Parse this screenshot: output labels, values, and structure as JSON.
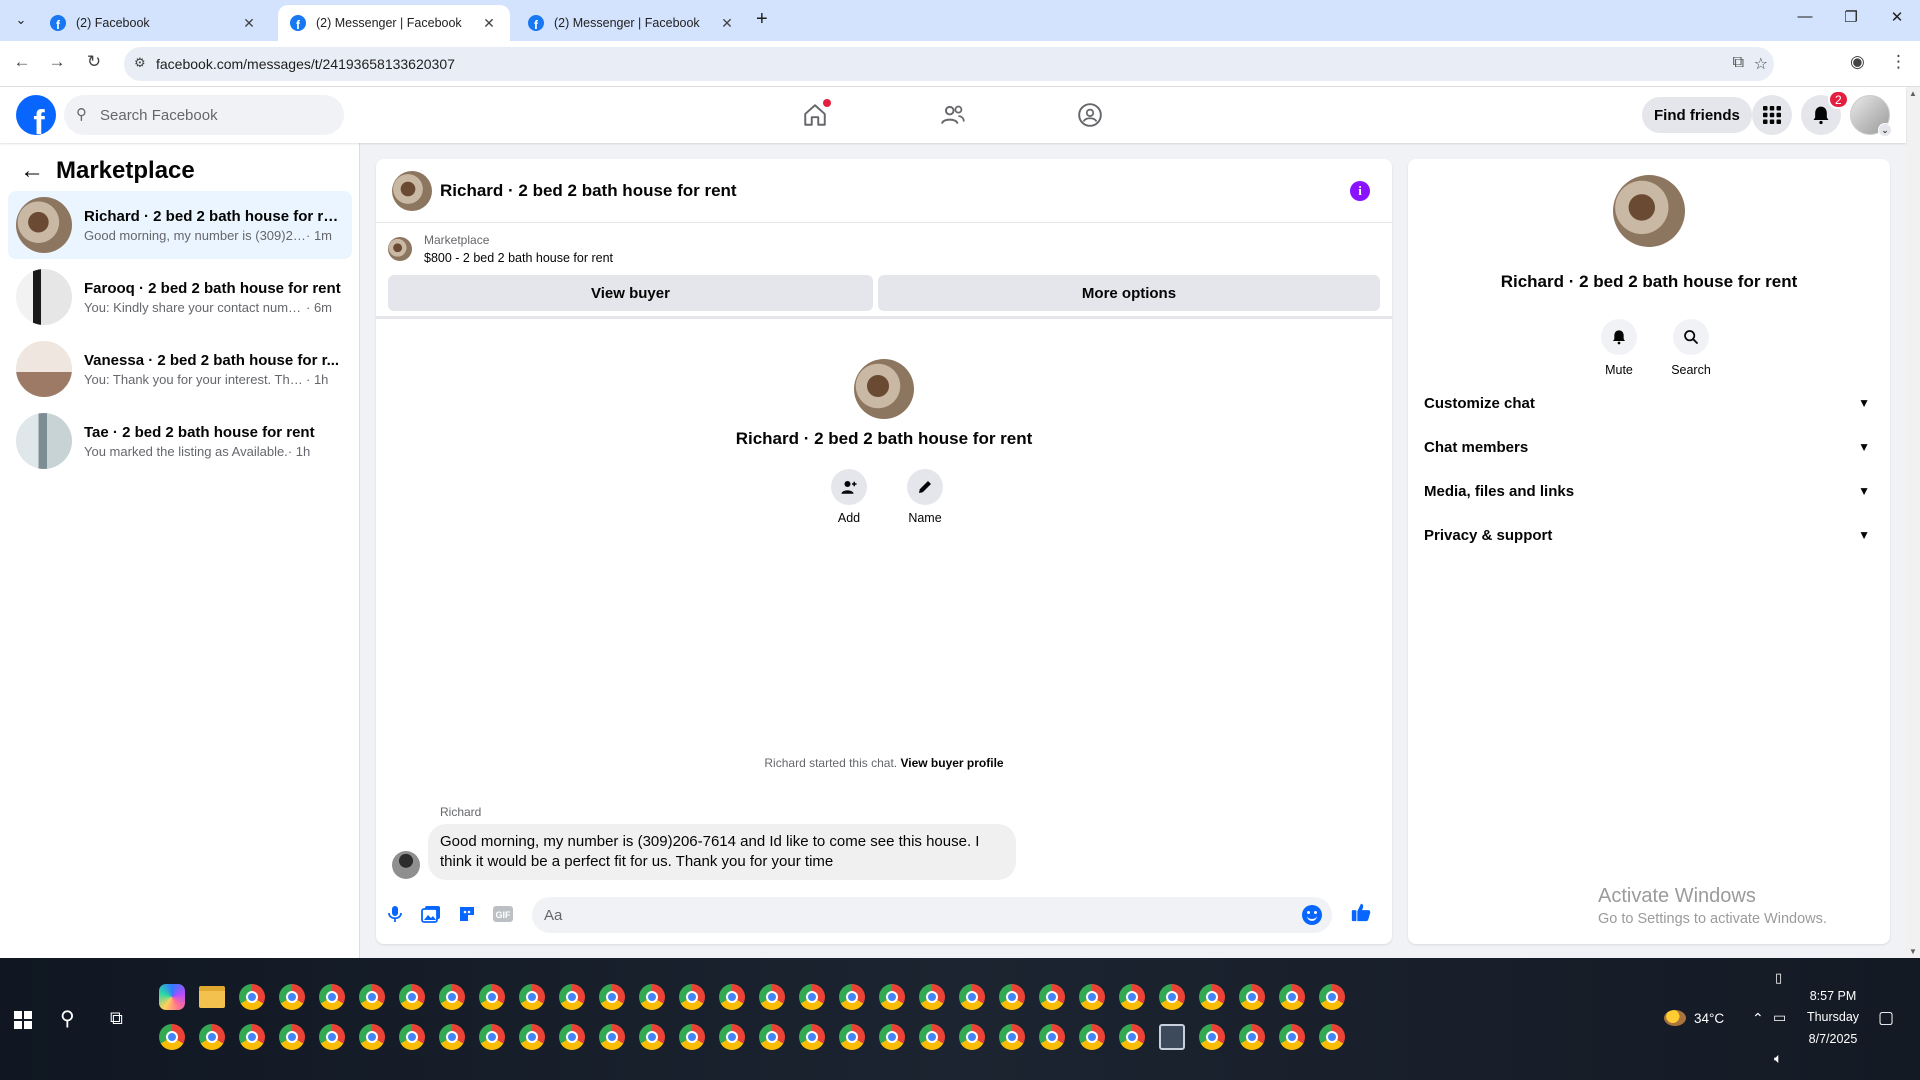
{
  "browser": {
    "tabs": [
      {
        "title": "(2) Facebook",
        "active": false
      },
      {
        "title": "(2) Messenger | Facebook",
        "active": true
      },
      {
        "title": "(2) Messenger | Facebook",
        "active": false
      }
    ],
    "url": "facebook.com/messages/t/24193658133620307"
  },
  "fb_header": {
    "logo_letter": "f",
    "search_placeholder": "Search Facebook",
    "find_friends": "Find friends",
    "notification_count": "2"
  },
  "sidebar": {
    "title": "Marketplace",
    "conversations": [
      {
        "name": "Richard · 2 bed 2 bath house for re...",
        "preview": "Good morning, my number is (309)20...",
        "time": " · 1m",
        "selected": true
      },
      {
        "name": "Farooq · 2 bed 2 bath house for rent",
        "preview": "You: Kindly share your contact number",
        "time": " · 6m",
        "selected": false
      },
      {
        "name": "Vanessa · 2 bed 2 bath house for r...",
        "preview": "You: Thank you for your interest. The ...",
        "time": " · 1h",
        "selected": false
      },
      {
        "name": "Tae · 2 bed 2 bath house for rent",
        "preview": "You marked the listing as Available.",
        "time": " · 1h",
        "selected": false
      }
    ]
  },
  "chat": {
    "title": "Richard · 2 bed 2 bath house for rent",
    "marketplace_label": "Marketplace",
    "listing": "$800 - 2 bed 2 bath house for rent",
    "view_buyer": "View buyer",
    "more_options": "More options",
    "intro_name": "Richard · 2 bed 2 bath house for rent",
    "add_label": "Add",
    "name_label": "Name",
    "started_text": "Richard started this chat. ",
    "view_buyer_profile": "View buyer profile",
    "sender": "Richard",
    "message": "Good morning, my number is (309)206-7614 and Id like to come see this house. I think it would be a perfect fit for us. Thank you for your time",
    "composer_placeholder": "Aa"
  },
  "info_panel": {
    "name": "Richard · 2 bed 2 bath house for rent",
    "mute": "Mute",
    "search": "Search",
    "sections": [
      "Customize chat",
      "Chat members",
      "Media, files and links",
      "Privacy & support"
    ],
    "watermark_line1": "Activate Windows",
    "watermark_line2": "Go to Settings to activate Windows."
  },
  "taskbar": {
    "temperature": "34°C",
    "time": "8:57 PM",
    "day": "Thursday",
    "date": "8/7/2025"
  },
  "colors": {
    "fb_blue": "#0866ff",
    "selected_conv_bg": "#ebf5ff",
    "info_purple": "#8a12ff",
    "badge_red": "#e41e3f"
  }
}
